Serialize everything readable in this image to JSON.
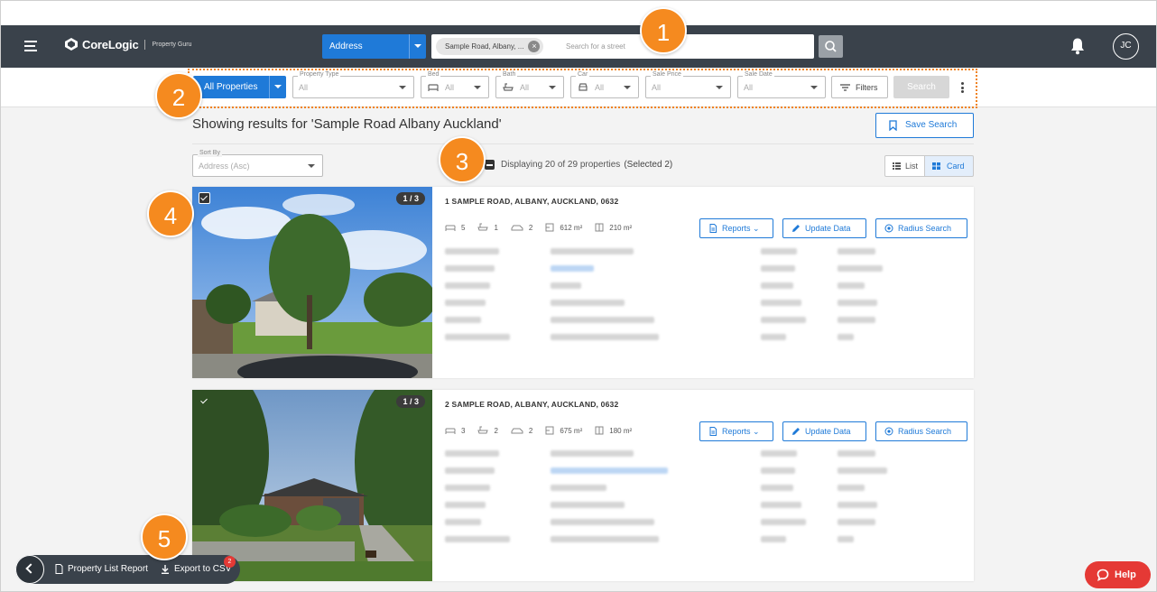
{
  "app": {
    "brand": "CoreLogic",
    "brand_sub": "Property Guru",
    "user_initials": "JC"
  },
  "search": {
    "type_label": "Address",
    "chip_text": "Sample Road, Albany, ...",
    "placeholder": "Search for a street"
  },
  "filters": {
    "all_properties": "All Properties",
    "property_type": {
      "label": "Property Type",
      "value": "All"
    },
    "bed": {
      "label": "Bed",
      "value": "All"
    },
    "bath": {
      "label": "Bath",
      "value": "All"
    },
    "car": {
      "label": "Car",
      "value": "All"
    },
    "sale_price": {
      "label": "Sale Price",
      "value": "All"
    },
    "sale_date": {
      "label": "Sale Date",
      "value": "All"
    },
    "filters_label": "Filters",
    "search_label": "Search"
  },
  "results": {
    "heading": "Showing results for 'Sample Road Albany Auckland'",
    "save_search": "Save Search",
    "sort_label": "Sort By",
    "sort_value": "Address (Asc)",
    "displaying": "Displaying 20 of 29 properties",
    "selected": "(Selected 2)",
    "view_list": "List",
    "view_card": "Card"
  },
  "properties": [
    {
      "address": "1 SAMPLE ROAD, ALBANY, AUCKLAND, 0632",
      "photo_count": "1 / 3",
      "beds": "5",
      "baths": "1",
      "cars": "2",
      "land": "612 m²",
      "floor": "210 m²"
    },
    {
      "address": "2 SAMPLE ROAD, ALBANY, AUCKLAND, 0632",
      "photo_count": "1 / 3",
      "beds": "3",
      "baths": "2",
      "cars": "2",
      "land": "675 m²",
      "floor": "180 m²"
    }
  ],
  "card_actions": {
    "reports": "Reports",
    "update_data": "Update Data",
    "radius_search": "Radius Search"
  },
  "bottom_bar": {
    "report": "Property List Report",
    "export": "Export to CSV",
    "export_badge": "2"
  },
  "help_label": "Help",
  "callouts": [
    "1",
    "2",
    "3",
    "4",
    "5"
  ],
  "colors": {
    "navbar": "#3a424b",
    "primary": "#1f7ad8",
    "callout": "#f58a1f",
    "help": "#e53935"
  }
}
